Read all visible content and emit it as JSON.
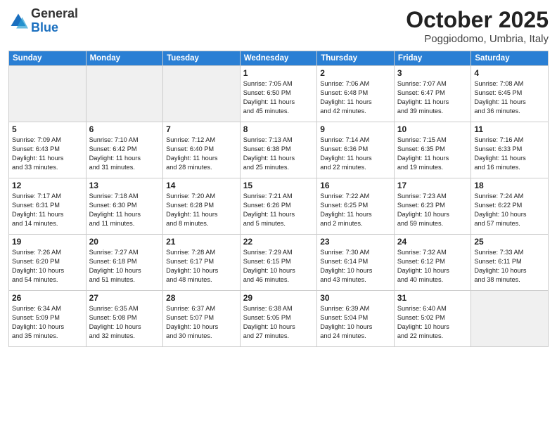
{
  "header": {
    "logo_line1": "General",
    "logo_line2": "Blue",
    "month": "October 2025",
    "location": "Poggiodomo, Umbria, Italy"
  },
  "weekdays": [
    "Sunday",
    "Monday",
    "Tuesday",
    "Wednesday",
    "Thursday",
    "Friday",
    "Saturday"
  ],
  "weeks": [
    [
      {
        "day": "",
        "info": ""
      },
      {
        "day": "",
        "info": ""
      },
      {
        "day": "",
        "info": ""
      },
      {
        "day": "1",
        "info": "Sunrise: 7:05 AM\nSunset: 6:50 PM\nDaylight: 11 hours\nand 45 minutes."
      },
      {
        "day": "2",
        "info": "Sunrise: 7:06 AM\nSunset: 6:48 PM\nDaylight: 11 hours\nand 42 minutes."
      },
      {
        "day": "3",
        "info": "Sunrise: 7:07 AM\nSunset: 6:47 PM\nDaylight: 11 hours\nand 39 minutes."
      },
      {
        "day": "4",
        "info": "Sunrise: 7:08 AM\nSunset: 6:45 PM\nDaylight: 11 hours\nand 36 minutes."
      }
    ],
    [
      {
        "day": "5",
        "info": "Sunrise: 7:09 AM\nSunset: 6:43 PM\nDaylight: 11 hours\nand 33 minutes."
      },
      {
        "day": "6",
        "info": "Sunrise: 7:10 AM\nSunset: 6:42 PM\nDaylight: 11 hours\nand 31 minutes."
      },
      {
        "day": "7",
        "info": "Sunrise: 7:12 AM\nSunset: 6:40 PM\nDaylight: 11 hours\nand 28 minutes."
      },
      {
        "day": "8",
        "info": "Sunrise: 7:13 AM\nSunset: 6:38 PM\nDaylight: 11 hours\nand 25 minutes."
      },
      {
        "day": "9",
        "info": "Sunrise: 7:14 AM\nSunset: 6:36 PM\nDaylight: 11 hours\nand 22 minutes."
      },
      {
        "day": "10",
        "info": "Sunrise: 7:15 AM\nSunset: 6:35 PM\nDaylight: 11 hours\nand 19 minutes."
      },
      {
        "day": "11",
        "info": "Sunrise: 7:16 AM\nSunset: 6:33 PM\nDaylight: 11 hours\nand 16 minutes."
      }
    ],
    [
      {
        "day": "12",
        "info": "Sunrise: 7:17 AM\nSunset: 6:31 PM\nDaylight: 11 hours\nand 14 minutes."
      },
      {
        "day": "13",
        "info": "Sunrise: 7:18 AM\nSunset: 6:30 PM\nDaylight: 11 hours\nand 11 minutes."
      },
      {
        "day": "14",
        "info": "Sunrise: 7:20 AM\nSunset: 6:28 PM\nDaylight: 11 hours\nand 8 minutes."
      },
      {
        "day": "15",
        "info": "Sunrise: 7:21 AM\nSunset: 6:26 PM\nDaylight: 11 hours\nand 5 minutes."
      },
      {
        "day": "16",
        "info": "Sunrise: 7:22 AM\nSunset: 6:25 PM\nDaylight: 11 hours\nand 2 minutes."
      },
      {
        "day": "17",
        "info": "Sunrise: 7:23 AM\nSunset: 6:23 PM\nDaylight: 10 hours\nand 59 minutes."
      },
      {
        "day": "18",
        "info": "Sunrise: 7:24 AM\nSunset: 6:22 PM\nDaylight: 10 hours\nand 57 minutes."
      }
    ],
    [
      {
        "day": "19",
        "info": "Sunrise: 7:26 AM\nSunset: 6:20 PM\nDaylight: 10 hours\nand 54 minutes."
      },
      {
        "day": "20",
        "info": "Sunrise: 7:27 AM\nSunset: 6:18 PM\nDaylight: 10 hours\nand 51 minutes."
      },
      {
        "day": "21",
        "info": "Sunrise: 7:28 AM\nSunset: 6:17 PM\nDaylight: 10 hours\nand 48 minutes."
      },
      {
        "day": "22",
        "info": "Sunrise: 7:29 AM\nSunset: 6:15 PM\nDaylight: 10 hours\nand 46 minutes."
      },
      {
        "day": "23",
        "info": "Sunrise: 7:30 AM\nSunset: 6:14 PM\nDaylight: 10 hours\nand 43 minutes."
      },
      {
        "day": "24",
        "info": "Sunrise: 7:32 AM\nSunset: 6:12 PM\nDaylight: 10 hours\nand 40 minutes."
      },
      {
        "day": "25",
        "info": "Sunrise: 7:33 AM\nSunset: 6:11 PM\nDaylight: 10 hours\nand 38 minutes."
      }
    ],
    [
      {
        "day": "26",
        "info": "Sunrise: 6:34 AM\nSunset: 5:09 PM\nDaylight: 10 hours\nand 35 minutes."
      },
      {
        "day": "27",
        "info": "Sunrise: 6:35 AM\nSunset: 5:08 PM\nDaylight: 10 hours\nand 32 minutes."
      },
      {
        "day": "28",
        "info": "Sunrise: 6:37 AM\nSunset: 5:07 PM\nDaylight: 10 hours\nand 30 minutes."
      },
      {
        "day": "29",
        "info": "Sunrise: 6:38 AM\nSunset: 5:05 PM\nDaylight: 10 hours\nand 27 minutes."
      },
      {
        "day": "30",
        "info": "Sunrise: 6:39 AM\nSunset: 5:04 PM\nDaylight: 10 hours\nand 24 minutes."
      },
      {
        "day": "31",
        "info": "Sunrise: 6:40 AM\nSunset: 5:02 PM\nDaylight: 10 hours\nand 22 minutes."
      },
      {
        "day": "",
        "info": ""
      }
    ]
  ]
}
